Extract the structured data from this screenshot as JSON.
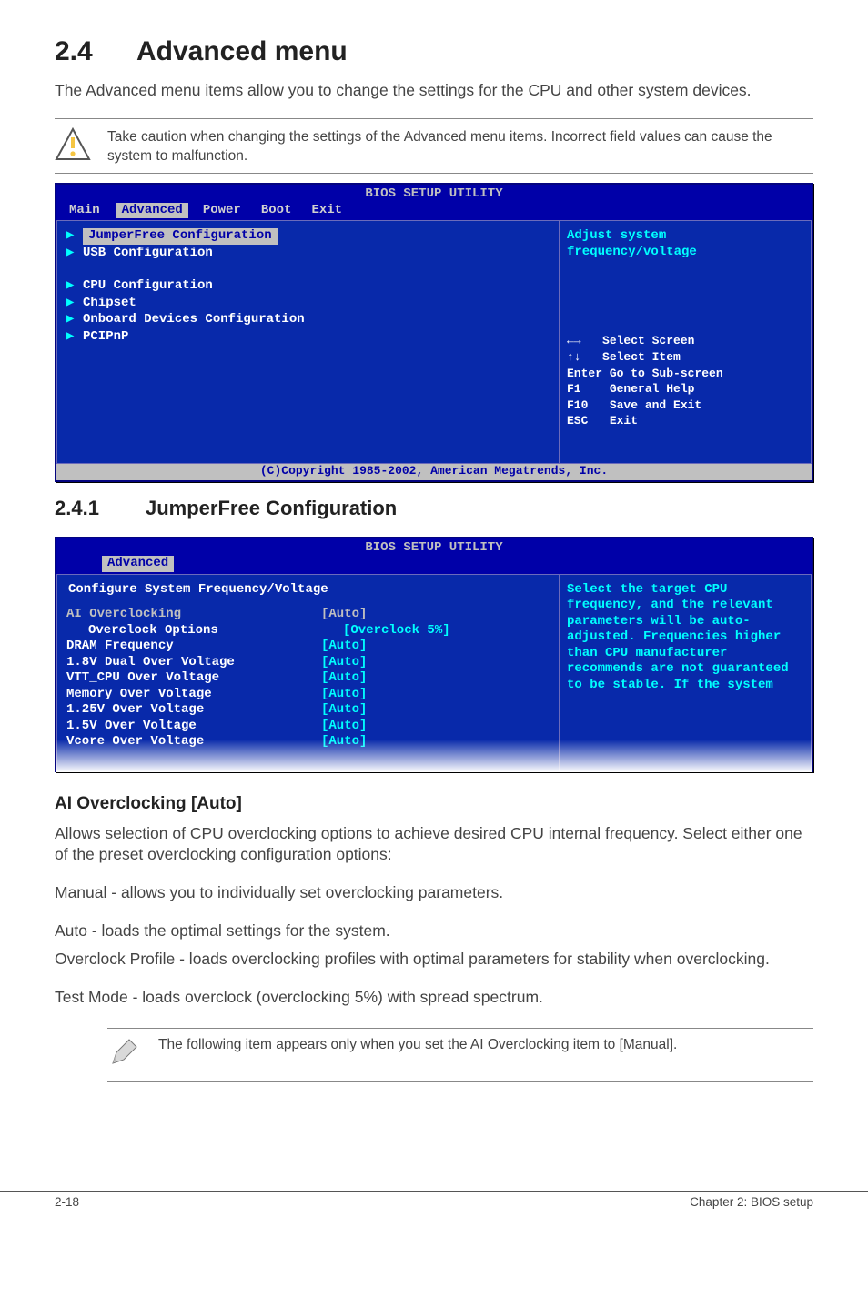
{
  "section": {
    "num": "2.4",
    "title": "Advanced menu"
  },
  "intro": "The Advanced menu items allow you to change the settings for the CPU and other system devices.",
  "caution": "Take caution when changing the settings of the Advanced menu items. Incorrect field values can cause the system to malfunction.",
  "bios1": {
    "title": "BIOS SETUP UTILITY",
    "tabs": [
      "Main",
      "Advanced",
      "Power",
      "Boot",
      "Exit"
    ],
    "active_tab": "Advanced",
    "left_top": [
      {
        "label": "JumperFree Configuration",
        "selected": true
      },
      {
        "label": "USB Configuration",
        "selected": false
      }
    ],
    "left_bottom": [
      "CPU Configuration",
      "Chipset",
      "Onboard Devices Configuration",
      "PCIPnP"
    ],
    "right_help_title": "Adjust system\nfrequency/voltage",
    "keys": [
      {
        "k": "←→",
        "d": "Select Screen"
      },
      {
        "k": "↑↓",
        "d": "Select Item"
      },
      {
        "k": "Enter",
        "d": "Go to Sub-screen"
      },
      {
        "k": "F1",
        "d": "General Help"
      },
      {
        "k": "F10",
        "d": "Save and Exit"
      },
      {
        "k": "ESC",
        "d": "Exit"
      }
    ],
    "copyright": "(C)Copyright 1985-2002, American Megatrends, Inc."
  },
  "subsection": {
    "num": "2.4.1",
    "title": "JumperFree Configuration"
  },
  "bios2": {
    "title": "BIOS SETUP UTILITY",
    "tab": "Advanced",
    "cfg_head": "Configure System Frequency/Voltage",
    "rows": [
      {
        "k": "AI Overclocking",
        "v": "[Auto]",
        "sel": true,
        "indent": 0
      },
      {
        "k": "Overclock Options",
        "v": "[Overclock 5%]",
        "sel": false,
        "indent": 1
      },
      {
        "k": "DRAM Frequency",
        "v": "[Auto]",
        "sel": false,
        "indent": 0
      },
      {
        "k": "",
        "v": "",
        "sel": false,
        "indent": 0
      },
      {
        "k": "1.8V Dual Over Voltage",
        "v": "[Auto]",
        "sel": false,
        "indent": 0
      },
      {
        "k": "VTT_CPU Over Voltage",
        "v": "[Auto]",
        "sel": false,
        "indent": 0
      },
      {
        "k": "Memory Over Voltage",
        "v": "[Auto]",
        "sel": false,
        "indent": 0
      },
      {
        "k": "1.25V Over Voltage",
        "v": "[Auto]",
        "sel": false,
        "indent": 0
      },
      {
        "k": "1.5V Over Voltage",
        "v": "[Auto]",
        "sel": false,
        "indent": 0
      },
      {
        "k": "Vcore Over Voltage",
        "v": "[Auto]",
        "sel": false,
        "indent": 0
      }
    ],
    "right_help": "Select the target CPU frequency, and the relevant parameters will be auto-adjusted. Frequencies higher than CPU manufacturer recommends are not guaranteed to be stable. If the system"
  },
  "item_head": "AI Overclocking [Auto]",
  "paras": [
    "Allows selection of CPU overclocking options to achieve desired CPU internal frequency. Select either one of the preset overclocking configuration options:",
    "Manual - allows you to individually set overclocking parameters.",
    "Auto - loads the optimal settings for the system.",
    "Overclock Profile - loads overclocking profiles with optimal parameters for stability when overclocking.",
    "Test Mode - loads overclock (overclocking 5%) with spread spectrum."
  ],
  "note2": "The following item appears only when you set the AI Overclocking item to [Manual].",
  "footer": {
    "left": "2-18",
    "right": "Chapter 2: BIOS setup"
  }
}
